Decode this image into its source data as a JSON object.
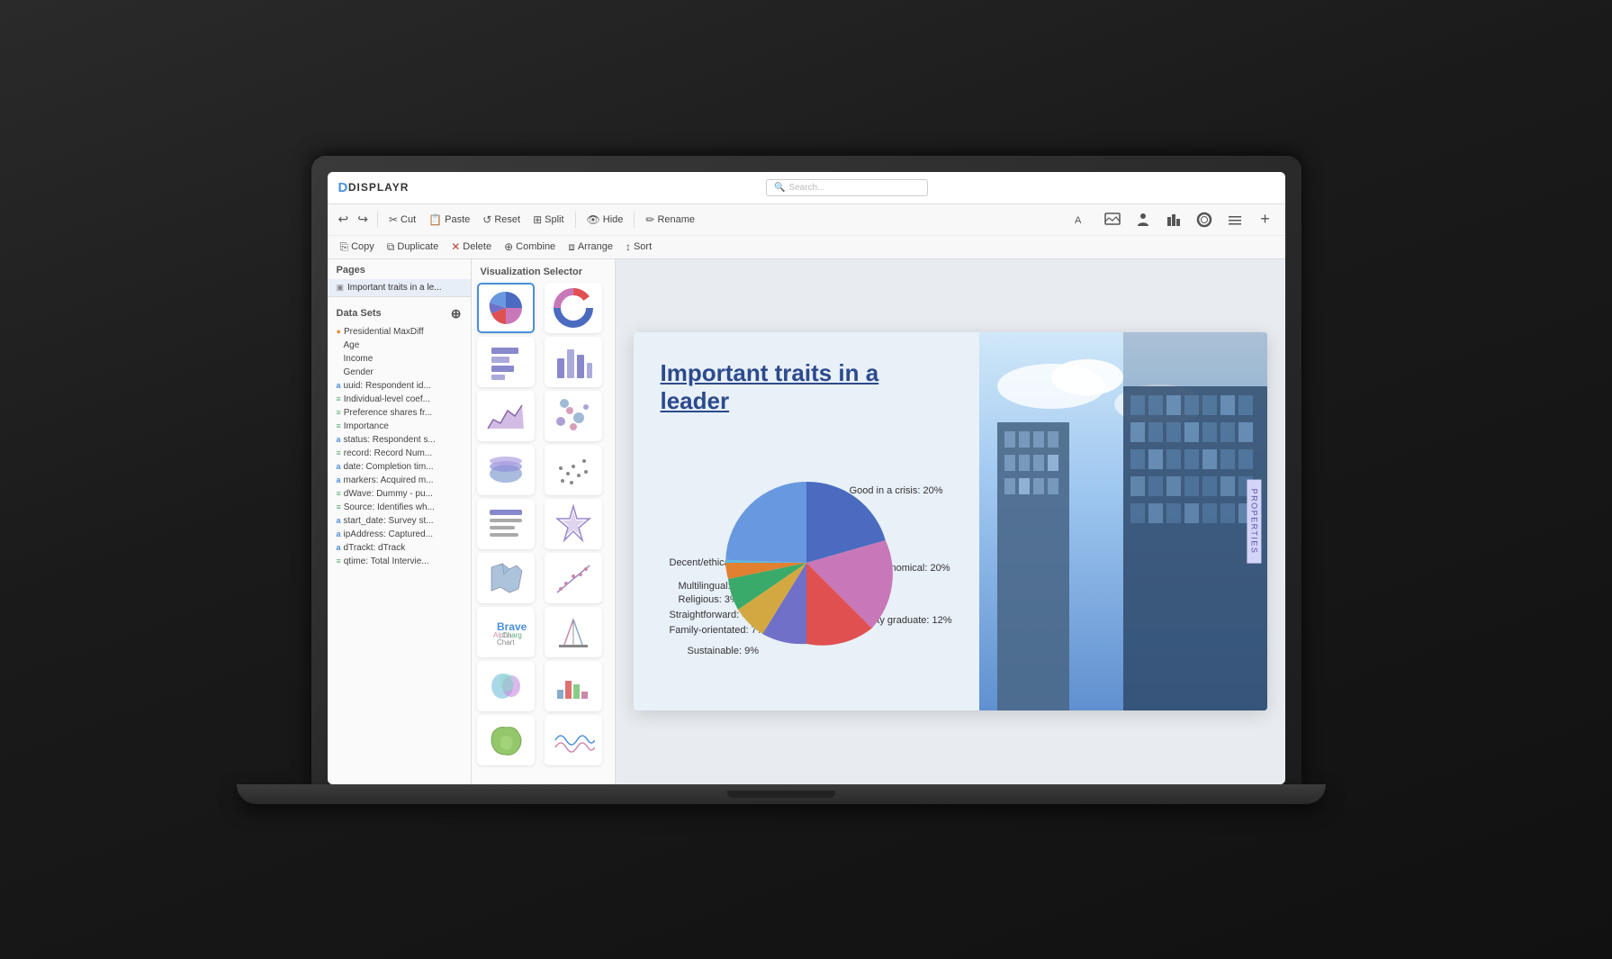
{
  "app": {
    "logo": "DISPLAYR",
    "search_placeholder": "Search..."
  },
  "toolbar_row1": {
    "undo_label": "↩",
    "redo_label": "↪",
    "cut_label": "Cut",
    "paste_label": "Paste",
    "reset_label": "Reset",
    "split_label": "Split",
    "hide_label": "Hide",
    "rename_label": "Rename"
  },
  "toolbar_row2": {
    "copy_label": "Copy",
    "duplicate_label": "Duplicate",
    "delete_label": "Delete",
    "combine_label": "Combine",
    "arrange_label": "Arrange",
    "sort_label": "Sort"
  },
  "pages": {
    "title": "Pages",
    "items": [
      {
        "label": "Important traits in a le..."
      }
    ]
  },
  "viz_selector": {
    "title": "Visualization Selector",
    "items": [
      "pie-chart",
      "donut-chart",
      "bar-chart-h",
      "bar-chart-v",
      "area-chart",
      "scatter-multi",
      "bowl-chart",
      "scatter-chart",
      "text-chart",
      "star-chart",
      "map-chart",
      "regression-chart",
      "stat-icon",
      "building-chart",
      "blob-chart",
      "waterfall-chart",
      "map-shape-chart",
      "wave-chart"
    ]
  },
  "slide": {
    "title": "Important traits in a leader",
    "chart": {
      "segments": [
        {
          "label": "Good in a crisis: 20%",
          "value": 20,
          "color": "#4a6bbf",
          "angle_start": -90,
          "angle_end": -18
        },
        {
          "label": "Economical: 20%",
          "value": 20,
          "color": "#c878b8",
          "angle_start": -18,
          "angle_end": 54
        },
        {
          "label": "University graduate: 12%",
          "value": 12,
          "color": "#e05050",
          "angle_start": 54,
          "angle_end": 97.2
        },
        {
          "label": "Sustainable: 9%",
          "value": 9,
          "color": "#7070c8",
          "angle_start": 97.2,
          "angle_end": 129.6
        },
        {
          "label": "Family-orientated: 7%",
          "value": 7,
          "color": "#c8a040",
          "angle_start": 129.6,
          "angle_end": 154.8
        },
        {
          "label": "Straightforward: 4%",
          "value": 4,
          "color": "#3aaa6a",
          "angle_start": 154.8,
          "angle_end": 169.2
        },
        {
          "label": "Religious: 3%",
          "value": 3,
          "color": "#e08030",
          "angle_start": 169.2,
          "angle_end": 180.0
        },
        {
          "label": "Multilingual: 1%",
          "value": 1,
          "color": "#60b8e0",
          "angle_start": 180.0,
          "angle_end": 183.6
        },
        {
          "label": "Decent/ethical: 24%",
          "value": 24,
          "color": "#6898e0",
          "angle_start": 183.6,
          "angle_end": 270
        }
      ]
    }
  },
  "datasets": {
    "title": "Data Sets",
    "items": [
      {
        "icon": "●",
        "color": "ds-orange",
        "label": "Presidential MaxDiff",
        "indent": 0
      },
      {
        "icon": " ",
        "color": "",
        "label": "Age",
        "indent": 1
      },
      {
        "icon": " ",
        "color": "",
        "label": "Income",
        "indent": 1
      },
      {
        "icon": " ",
        "color": "",
        "label": "Gender",
        "indent": 1
      },
      {
        "icon": "a",
        "color": "ds-blue",
        "label": "uuid: Respondent id...",
        "indent": 0
      },
      {
        "icon": "≡",
        "color": "ds-green",
        "label": "Individual-level coef...",
        "indent": 0
      },
      {
        "icon": "≡",
        "color": "ds-green",
        "label": "Preference shares fr...",
        "indent": 0
      },
      {
        "icon": "≡",
        "color": "ds-green",
        "label": "Importance",
        "indent": 0
      },
      {
        "icon": "a",
        "color": "ds-blue",
        "label": "status: Respondent s...",
        "indent": 0
      },
      {
        "icon": "≡",
        "color": "ds-green",
        "label": "record: Record Num...",
        "indent": 0
      },
      {
        "icon": "a",
        "color": "ds-blue",
        "label": "date: Completion tim...",
        "indent": 0
      },
      {
        "icon": "a",
        "color": "ds-blue",
        "label": "markers: Acquired m...",
        "indent": 0
      },
      {
        "icon": "≡",
        "color": "ds-green",
        "label": "dWave: Dummy - pu...",
        "indent": 0
      },
      {
        "icon": "≡",
        "color": "ds-green",
        "label": "Source: Identifies wh...",
        "indent": 0
      },
      {
        "icon": "a",
        "color": "ds-blue",
        "label": "start_date: Survey st...",
        "indent": 0
      },
      {
        "icon": "a",
        "color": "ds-blue",
        "label": "ipAddress: Captured...",
        "indent": 0
      },
      {
        "icon": "a",
        "color": "ds-blue",
        "label": "dTrackt: dTrack",
        "indent": 0
      },
      {
        "icon": "≡",
        "color": "ds-green",
        "label": "qtime: Total Intervie...",
        "indent": 0
      }
    ]
  },
  "properties_tab": "PROPERTIES"
}
